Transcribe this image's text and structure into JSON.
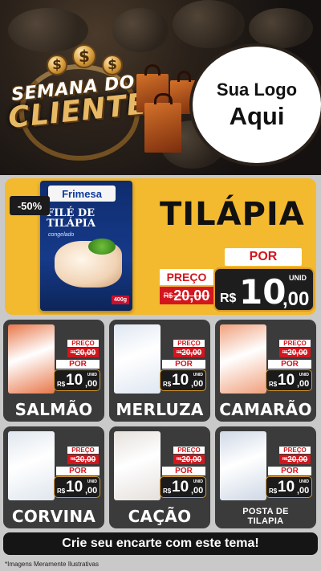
{
  "header": {
    "title_line1": "SEMANA DO",
    "title_line2": "CLIENTE",
    "logo_placeholder_line1": "Sua Logo",
    "logo_placeholder_line2": "Aqui",
    "dollar_symbol": "$"
  },
  "featured": {
    "discount": "-50%",
    "product_name": "TILÁPIA",
    "package_brand": "Frimesa",
    "package_title_line1": "FILÉ DE",
    "package_title_line2": "TILÁPIA",
    "package_subtitle": "congelado",
    "package_weight": "400g",
    "preco_label": "PREÇO",
    "old_price_currency": "R$",
    "old_price": "20,00",
    "por_label": "POR",
    "new_price_currency": "R$",
    "new_price_int": "10",
    "new_price_dec": ",00",
    "unit": "UNID"
  },
  "product_price": {
    "preco_label": "PREÇO",
    "old_currency": "R$",
    "old_price": "20,00",
    "por_label": "POR",
    "new_currency": "R$",
    "new_int": "10",
    "new_dec": ",00",
    "unit": "UNID"
  },
  "products": [
    {
      "name": "SALMÃO",
      "image": "salmon-pack",
      "color": "#e8774a"
    },
    {
      "name": "MERLUZA",
      "image": "hake-pack",
      "color": "#dfe7f2"
    },
    {
      "name": "CAMARÃO",
      "image": "shrimp-pack",
      "color": "#f0a07c"
    },
    {
      "name": "CORVINA",
      "image": "croaker-pack",
      "color": "#dfe6ee"
    },
    {
      "name": "CAÇÃO",
      "image": "shark-steak-pack",
      "color": "#e5e0dc"
    },
    {
      "name_line1": "POSTA DE",
      "name_line2": "TILAPIA",
      "image": "tilapia-steak-pack",
      "color": "#cfd8e6"
    }
  ],
  "cta": "Crie seu encarte com este tema!",
  "disclaimer": "*Imagens Meramente Ilustrativas",
  "colors": {
    "gold": "#f3b92f",
    "red": "#d3161d",
    "dark": "#3b3b3b"
  }
}
